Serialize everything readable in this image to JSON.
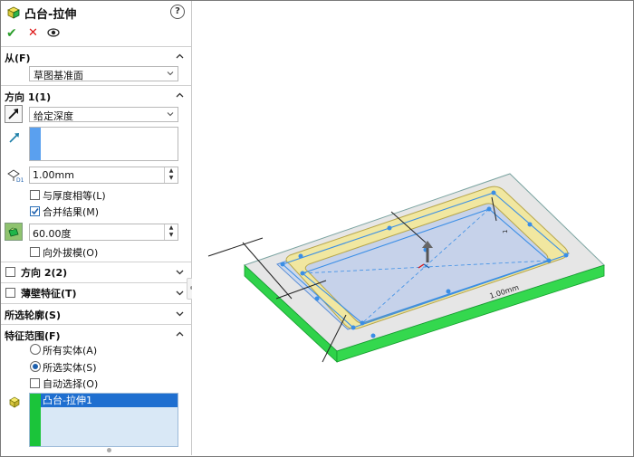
{
  "panel": {
    "title": "凸台-拉伸",
    "help": "?"
  },
  "from": {
    "header": "从(F)",
    "value": "草图基准面"
  },
  "direction1": {
    "header": "方向 1(1)",
    "end_condition": "给定深度",
    "depth": "1.00mm",
    "equal_thickness": "与厚度相等(L)",
    "merge_result": "合并结果(M)",
    "draft_angle": "60.00度",
    "draft_outward": "向外拔模(O)"
  },
  "direction2": {
    "header": "方向 2(2)"
  },
  "thin_feature": {
    "header": "薄壁特征(T)"
  },
  "selected_contours": {
    "header": "所选轮廓(S)"
  },
  "feature_scope": {
    "header": "特征范围(F)",
    "all_bodies": "所有实体(A)",
    "selected_bodies": "所选实体(S)",
    "auto_select": "自动选择(O)",
    "bodies": [
      "凸台-拉伸1"
    ]
  },
  "viewport": {
    "dimension_label": "1.00mm"
  },
  "colors": {
    "green_body": "#2fd24a",
    "preview_fill": "#c9d6ec",
    "ring_fill": "#f1e7a0",
    "handle_blue": "#3a8ee6"
  }
}
